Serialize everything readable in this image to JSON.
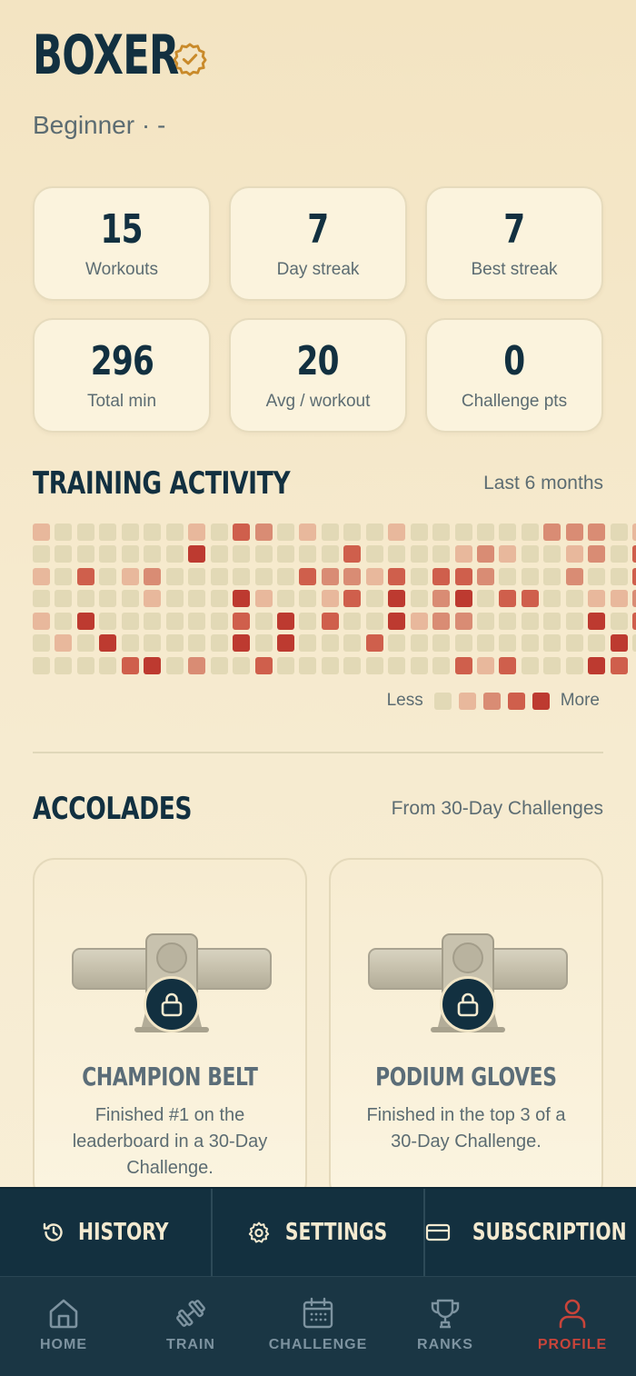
{
  "profile": {
    "name": "BOXER",
    "subtitle": "Beginner · -"
  },
  "stats": [
    {
      "value": "15",
      "label": "Workouts"
    },
    {
      "value": "7",
      "label": "Day streak"
    },
    {
      "value": "7",
      "label": "Best streak"
    },
    {
      "value": "296",
      "label": "Total min"
    },
    {
      "value": "20",
      "label": "Avg / workout"
    },
    {
      "value": "0",
      "label": "Challenge pts"
    }
  ],
  "activity": {
    "title": "TRAINING ACTIVITY",
    "range": "Last 6 months",
    "legend_less": "Less",
    "legend_more": "More",
    "colors": [
      "#e2d9b6",
      "#e8b89c",
      "#d98c74",
      "#cf5f4c",
      "#bd3a30"
    ],
    "weeks": [
      [
        1,
        0,
        1,
        0,
        1,
        0,
        0
      ],
      [
        0,
        0,
        0,
        0,
        0,
        1,
        0
      ],
      [
        0,
        0,
        3,
        0,
        4,
        0,
        0
      ],
      [
        0,
        0,
        0,
        0,
        0,
        4,
        0
      ],
      [
        0,
        0,
        1,
        0,
        0,
        0,
        3
      ],
      [
        0,
        0,
        2,
        1,
        0,
        0,
        4
      ],
      [
        0,
        0,
        0,
        0,
        0,
        0,
        0
      ],
      [
        1,
        4,
        0,
        0,
        0,
        0,
        2
      ],
      [
        0,
        0,
        0,
        0,
        0,
        0,
        0
      ],
      [
        3,
        0,
        0,
        4,
        3,
        4,
        0
      ],
      [
        2,
        0,
        0,
        1,
        0,
        0,
        3
      ],
      [
        0,
        0,
        0,
        0,
        4,
        4,
        0
      ],
      [
        1,
        0,
        3,
        0,
        0,
        0,
        0
      ],
      [
        0,
        0,
        2,
        1,
        3,
        0,
        0
      ],
      [
        0,
        3,
        2,
        3,
        0,
        0,
        0
      ],
      [
        0,
        0,
        1,
        0,
        0,
        3,
        0
      ],
      [
        1,
        0,
        3,
        4,
        4,
        0,
        0
      ],
      [
        0,
        0,
        0,
        0,
        1,
        0,
        0
      ],
      [
        0,
        0,
        3,
        2,
        2,
        0,
        0
      ],
      [
        0,
        1,
        3,
        4,
        2,
        0,
        3
      ],
      [
        0,
        2,
        2,
        0,
        0,
        0,
        1
      ],
      [
        0,
        1,
        0,
        3,
        0,
        0,
        3
      ],
      [
        0,
        0,
        0,
        3,
        0,
        0,
        0
      ],
      [
        2,
        0,
        0,
        0,
        0,
        0,
        0
      ],
      [
        2,
        1,
        2,
        0,
        0,
        0,
        0
      ],
      [
        2,
        2,
        0,
        1,
        4,
        0,
        4
      ],
      [
        0,
        0,
        0,
        1,
        0,
        4,
        3
      ],
      [
        1,
        3,
        3,
        2,
        3,
        0,
        0
      ]
    ]
  },
  "accolades": {
    "title": "ACCOLADES",
    "note": "From 30-Day Challenges",
    "items": [
      {
        "name": "CHAMPION BELT",
        "description": "Finished #1 on the leaderboard in a 30-Day Challenge.",
        "icon": "lock-icon"
      },
      {
        "name": "PODIUM GLOVES",
        "description": "Finished in the top 3 of a 30-Day Challenge.",
        "icon": "lock-icon"
      }
    ]
  },
  "actions": [
    {
      "label": "HISTORY",
      "icon": "history-icon"
    },
    {
      "label": "SETTINGS",
      "icon": "gear-icon"
    },
    {
      "label": "SUBSCRIPTION",
      "icon": "card-icon"
    }
  ],
  "nav": [
    {
      "label": "HOME",
      "icon": "home-icon"
    },
    {
      "label": "TRAIN",
      "icon": "dumbbell-icon"
    },
    {
      "label": "CHALLENGE",
      "icon": "calendar-icon"
    },
    {
      "label": "RANKS",
      "icon": "trophy-icon"
    },
    {
      "label": "PROFILE",
      "icon": "person-icon",
      "active": true
    }
  ],
  "colors": {
    "accent": "#c8443a",
    "navy": "#13303f",
    "gold": "#c98a2a"
  }
}
